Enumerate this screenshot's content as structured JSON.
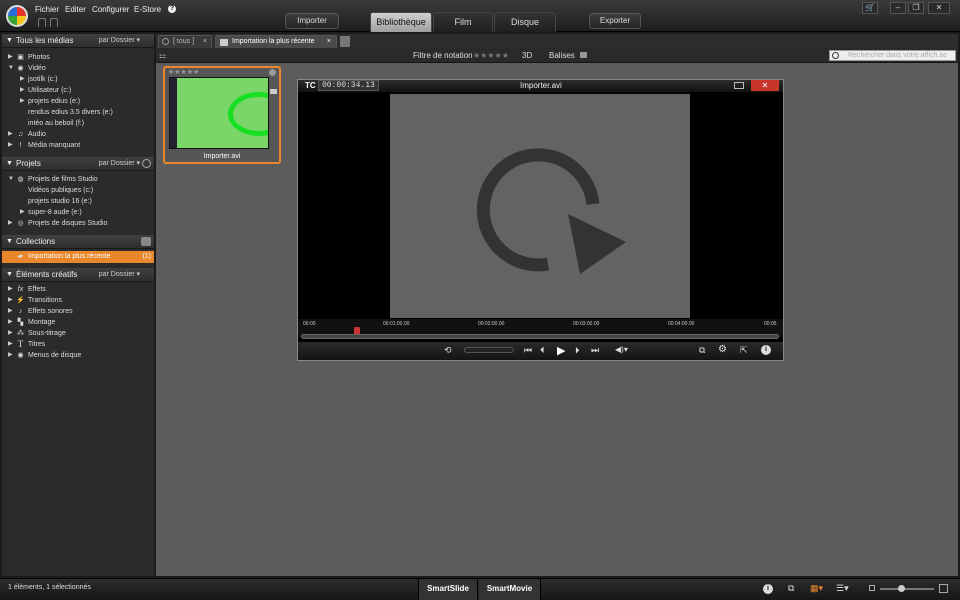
{
  "menu": {
    "file": "Fichier",
    "edit": "Editer",
    "configure": "Configurer",
    "estore": "E-Store",
    "help": "?"
  },
  "toolbar": {
    "import": "Importer",
    "export": "Exporter"
  },
  "tabs": [
    {
      "label": "Bibliothèque",
      "active": true
    },
    {
      "label": "Film",
      "active": false
    },
    {
      "label": "Disque",
      "active": false
    }
  ],
  "window_buttons": {
    "cart": "🛒",
    "minimize": "–",
    "restore": "❐",
    "close": "✕"
  },
  "sidebar": {
    "media": {
      "title": "Tous les médias",
      "sort": "par Dossier ▾",
      "items": [
        {
          "label": "Photos",
          "icon": "photo-icon"
        },
        {
          "label": "Vidéo",
          "icon": "video-icon"
        },
        {
          "label": "jsotilk (c:)"
        },
        {
          "label": "Utilisateur (c:)"
        },
        {
          "label": "projets edius (e:)"
        },
        {
          "label": "rendus edius 3.5 divers (e:)"
        },
        {
          "label": "intéo au beboil (f:)"
        },
        {
          "label": "Audio",
          "icon": "music-icon"
        },
        {
          "label": "Média manquant",
          "icon": "warning-icon"
        }
      ]
    },
    "projects": {
      "title": "Projets",
      "sort": "par Dossier ▾",
      "items": [
        {
          "label": "Projets de films Studio"
        },
        {
          "label": "Vidéos publiques (c:)"
        },
        {
          "label": "projets studio 16 (e:)"
        },
        {
          "label": "super-8 aude (e:)"
        },
        {
          "label": "Projets de disques Studio"
        }
      ]
    },
    "collections": {
      "title": "Collections",
      "selected_item": "Importation la plus récente",
      "selected_count": "(1)"
    },
    "creative": {
      "title": "Éléments créatifs",
      "sort": "par Dossier ▾",
      "items": [
        {
          "label": "Effets",
          "icon": "fx-icon"
        },
        {
          "label": "Transitions",
          "icon": "transition-icon"
        },
        {
          "label": "Effets sonores",
          "icon": "note-icon"
        },
        {
          "label": "Montage",
          "icon": "montage-icon"
        },
        {
          "label": "Sous-titrage",
          "icon": "subtitle-icon"
        },
        {
          "label": "Titres",
          "icon": "title-icon"
        },
        {
          "label": "Menus de disque",
          "icon": "disc-icon"
        }
      ]
    }
  },
  "browser": {
    "tab1": "[ tous ]",
    "tab2": "Importation la plus récente",
    "filter_label": "Filtre de notation",
    "stars": "★★★★★",
    "three_d": "3D",
    "tags": "Balises",
    "search_placeholder": "Rechercher dans votre affich.ac"
  },
  "thumbnail": {
    "caption": "Importer.avi",
    "stars": "★★★★★"
  },
  "player": {
    "tc_label": "TC",
    "timecode": "00:00:34.13",
    "title": "Importer.avi",
    "ticks": [
      "00:00",
      "00:01:00.00",
      "00:02:00.00",
      "00:03:00.00",
      "00:04:00.00",
      "00:05"
    ]
  },
  "status": {
    "text": "1 éléments, 1 sélectionnés",
    "smartslide": "SmartSlide",
    "smartmovie": "SmartMovie"
  },
  "colors": {
    "accent": "#e8872b",
    "thumb_green": "#7bd66a",
    "thumb_ring": "#17e023"
  }
}
